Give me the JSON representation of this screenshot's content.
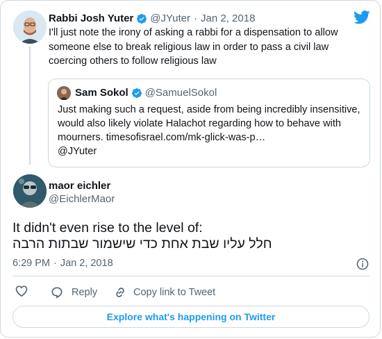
{
  "original_tweet": {
    "author_name": "Rabbi Josh Yuter",
    "handle": "@JYuter",
    "separator": "·",
    "date": "Jan 2, 2018",
    "text": "I'll just note the irony of asking a rabbi for a dispensation to allow someone else to break religious law in order to pass a civil law coercing others to follow religious law"
  },
  "quoted_tweet": {
    "author_name": "Sam Sokol",
    "handle": "@SamuelSokol",
    "text": "Just making such a request, aside from being incredibly insensitive, would also likely violate Halachot regarding how to behave with mourners. timesofisrael.com/mk-glick-was-p…",
    "mention": "@JYuter"
  },
  "reply_tweet": {
    "author_name": "maor eichler",
    "handle": "@EichlerMaor",
    "text_line1": "It didn't even rise to the level of:",
    "text_line2": "חלל עליו שבת אחת כדי שישמור שבתות הרבה",
    "time": "6:29 PM",
    "separator": "·",
    "date": "Jan 2, 2018"
  },
  "actions": {
    "reply_label": "Reply",
    "copy_link_label": "Copy link to Tweet"
  },
  "explore_button_label": "Explore what's happening on Twitter",
  "colors": {
    "twitter_blue": "#1d9bf0",
    "text_primary": "#0f1419",
    "text_secondary": "#536471",
    "border": "#cfd9de"
  },
  "icons": [
    "twitter-bird-icon",
    "verified-badge-icon",
    "heart-icon",
    "reply-icon",
    "link-icon",
    "info-icon"
  ]
}
